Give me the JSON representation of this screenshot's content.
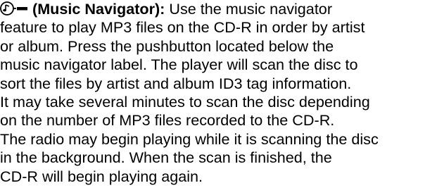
{
  "section": {
    "heading": "(Music Navigator):",
    "icon": "music-navigator-icon",
    "lines": [
      "Use the music navigator",
      "feature to play MP3 files on the CD-R in order by artist",
      "or album. Press the pushbutton located below the",
      "music navigator label. The player will scan the disc to",
      "sort the files by artist and album ID3 tag information.",
      "It may take several minutes to scan the disc depending",
      "on the number of MP3 files recorded to the CD-R.",
      "The radio may begin playing while it is scanning the disc",
      "in the background. When the scan is finished, the",
      "CD-R will begin playing again."
    ]
  }
}
